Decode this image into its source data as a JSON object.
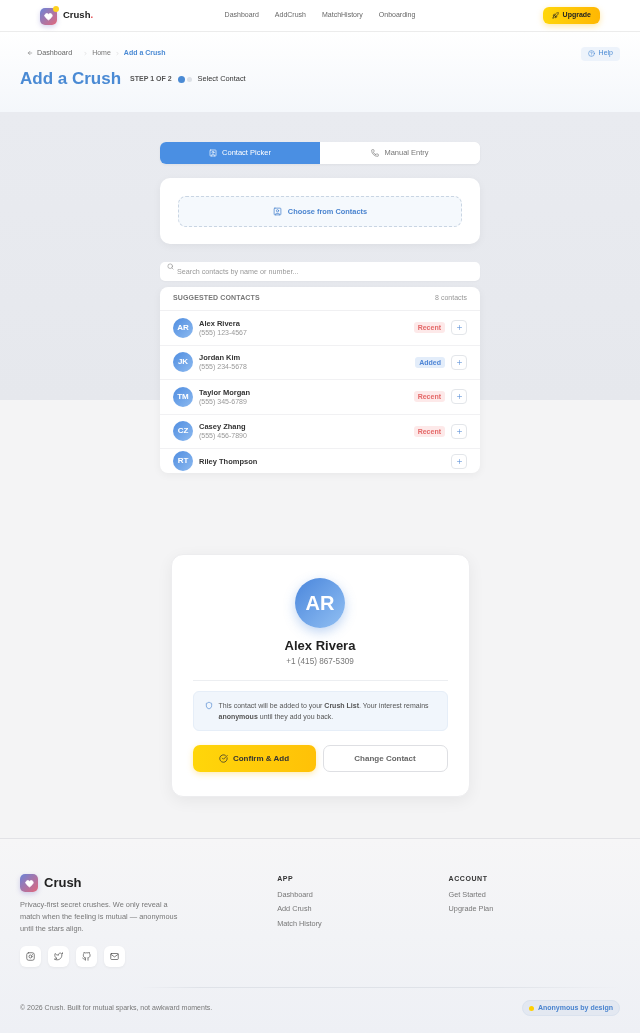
{
  "header": {
    "brand": {
      "name": "Crush",
      "dot": "."
    },
    "nav": [
      "Dashboard",
      "AddCrush",
      "MatchHistory",
      "Onboarding"
    ],
    "upgrade": "Upgrade"
  },
  "page_header": {
    "back": "Dashboard",
    "breadcrumb": [
      {
        "label": "Home",
        "current": false
      },
      {
        "label": "Add a Crush",
        "current": true
      }
    ],
    "help": "Help",
    "title": "Add a Crush",
    "step": {
      "label": "STEP 1 OF 2",
      "dots": [
        {
          "active": true
        },
        {
          "active": false
        }
      ],
      "name": "Select Contact"
    }
  },
  "tabs": [
    {
      "kind": "contact",
      "label": "Contact Picker",
      "selected": true
    },
    {
      "kind": "phone",
      "label": "Manual Entry",
      "selected": false
    }
  ],
  "picker": {
    "button": "Choose from Contacts"
  },
  "search": {
    "placeholder": "Search contacts by name or number..."
  },
  "contacts": {
    "title": "SUGGESTED CONTACTS",
    "count": "8 contacts",
    "items": [
      {
        "initials": "AR",
        "name": "Alex Rivera",
        "phone": "(555) 123-4567",
        "tag": {
          "kind": "recent",
          "label": "Recent"
        }
      },
      {
        "initials": "JK",
        "name": "Jordan Kim",
        "phone": "(555) 234-5678",
        "tag": {
          "kind": "added",
          "label": "Added"
        }
      },
      {
        "initials": "TM",
        "name": "Taylor Morgan",
        "phone": "(555) 345-6789",
        "tag": {
          "kind": "recent",
          "label": "Recent"
        }
      },
      {
        "initials": "CZ",
        "name": "Casey Zhang",
        "phone": "(555) 456-7890",
        "tag": {
          "kind": "recent",
          "label": "Recent"
        }
      },
      {
        "initials": "RT",
        "name": "Riley Thompson"
      }
    ]
  },
  "confirm": {
    "initials": "AR",
    "name": "Alex Rivera",
    "phone": "+1 (415) 867-5309",
    "note": "This contact will be added to your **Crush List**. Your interest remains **anonymous** until they add you back.",
    "confirm_button": "Confirm & Add",
    "change_button": "Change Contact"
  },
  "footer": {
    "brand": "Crush",
    "description": "Privacy-first secret crushes. We only reveal a match when the feeling is mutual — anonymous until the stars align.",
    "socials": [
      {
        "kind": "camera"
      },
      {
        "kind": "bird"
      },
      {
        "kind": "cat"
      },
      {
        "kind": "mail"
      }
    ],
    "columns": [
      {
        "title": "APP",
        "links": [
          "Dashboard",
          "Add Crush",
          "Match History"
        ]
      },
      {
        "title": "ACCOUNT",
        "links": [
          "Get Started",
          "Upgrade Plan"
        ]
      }
    ],
    "copyright": "© 2026 Crush. Built for mutual sparks, not awkward moments.",
    "badge": "Anonymous by design"
  }
}
